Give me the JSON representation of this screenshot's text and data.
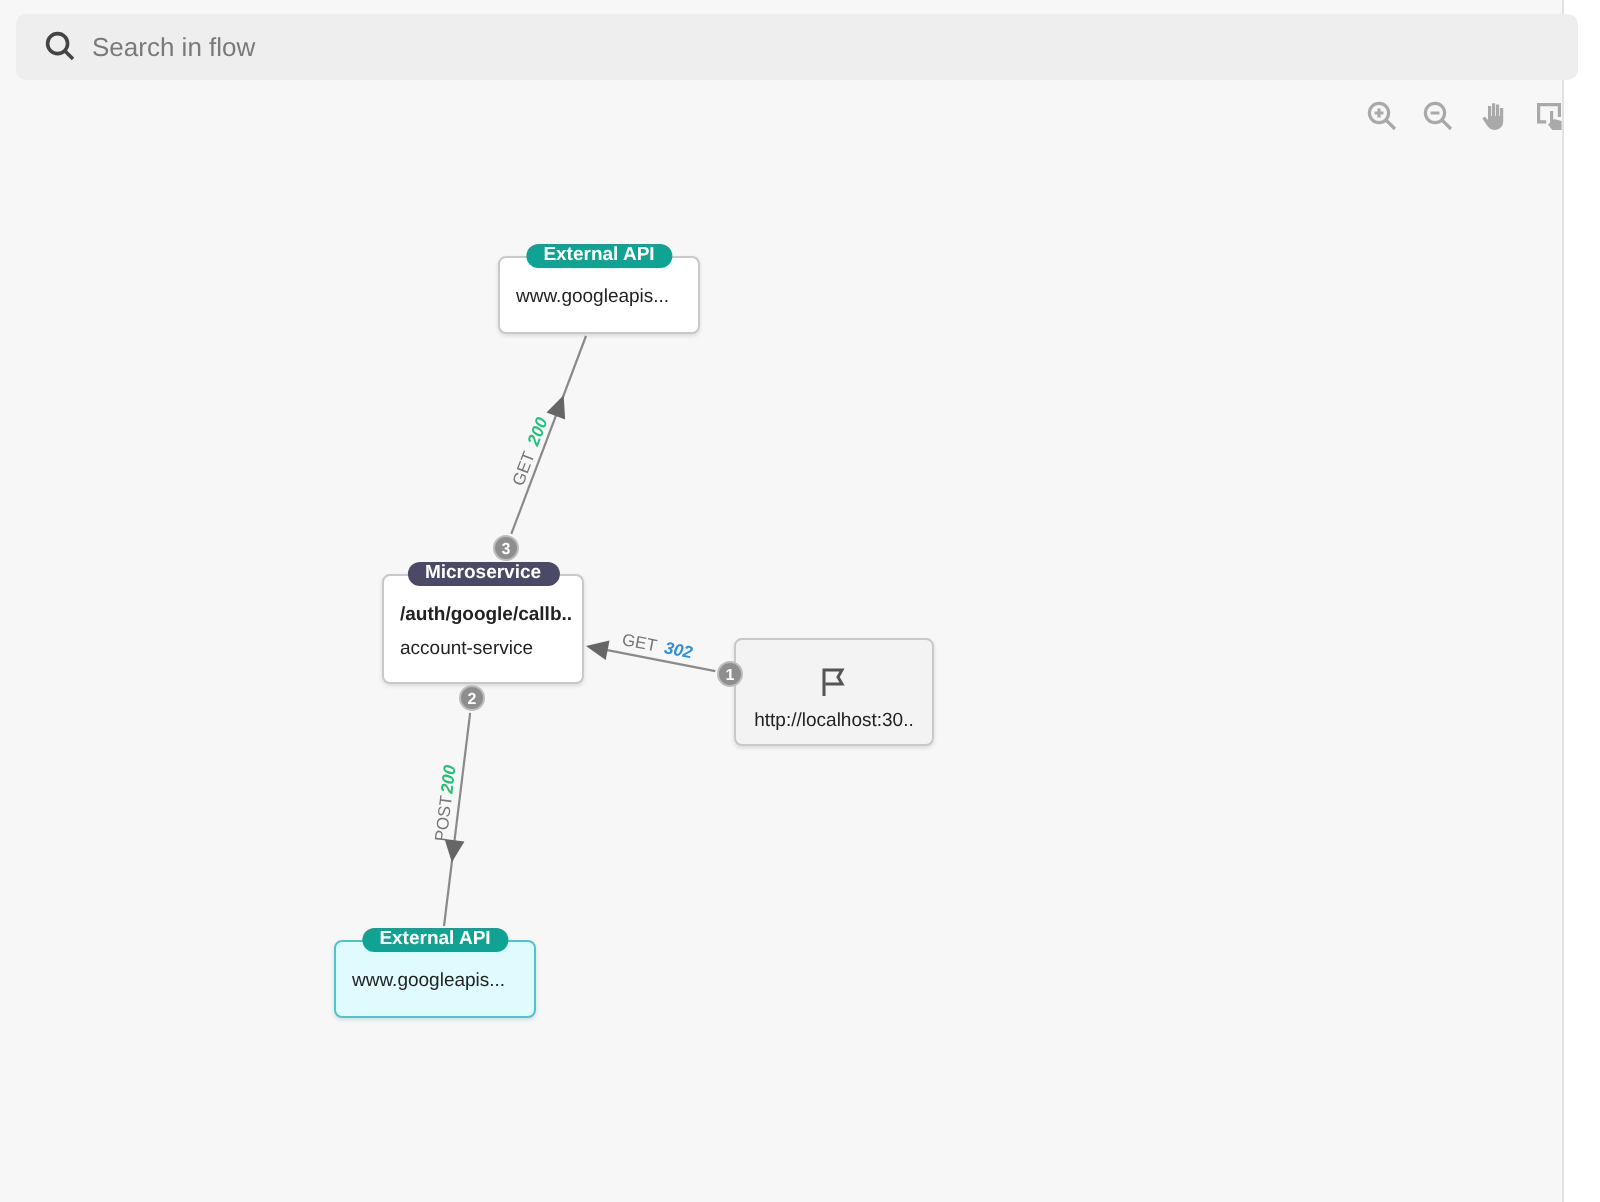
{
  "search": {
    "placeholder": "Search in flow"
  },
  "nodes": [
    {
      "kind": "external_api",
      "badge": "External API",
      "title": "www.googleapis...",
      "selected": false
    },
    {
      "kind": "microservice",
      "badge": "Microservice",
      "title": "/auth/google/callb..",
      "subtitle": "account-service",
      "selected": false
    },
    {
      "kind": "source",
      "title": "http://localhost:30..",
      "selected": false
    },
    {
      "kind": "external_api",
      "badge": "External API",
      "title": "www.googleapis...",
      "selected": true
    }
  ],
  "edges": [
    {
      "step": "3",
      "method": "GET",
      "status": "200",
      "color": "#22c07a"
    },
    {
      "step": "1",
      "method": "GET",
      "status": "302",
      "color": "#2d8fe0"
    },
    {
      "step": "2",
      "method": "POST",
      "status": "200",
      "color": "#22c07a"
    }
  ]
}
